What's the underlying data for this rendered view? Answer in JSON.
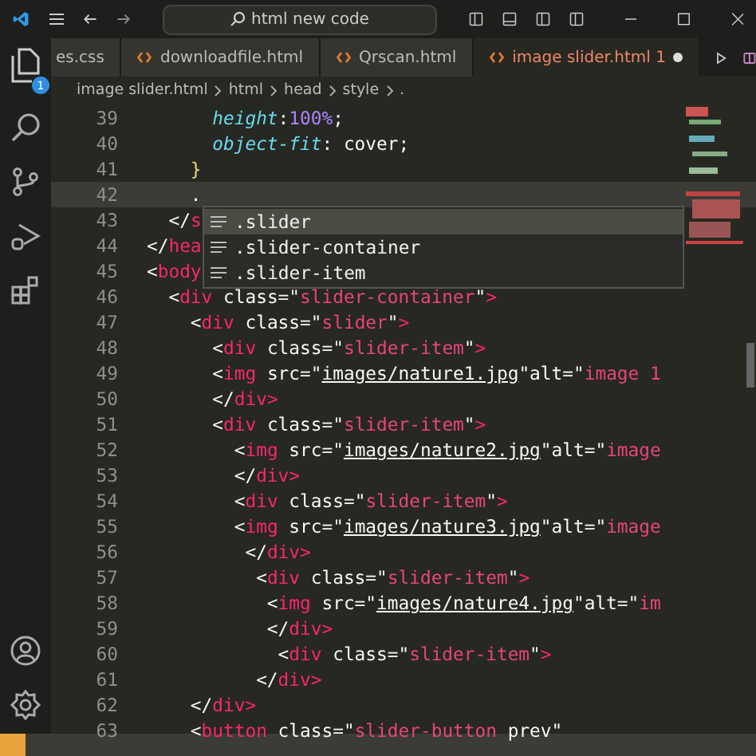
{
  "title_bar": {
    "search": "html new code"
  },
  "tabs": [
    {
      "label": "es.css",
      "selected": false,
      "icon": false
    },
    {
      "label": "downloadfile.html",
      "selected": false,
      "icon": true
    },
    {
      "label": "Qrscan.html",
      "selected": false,
      "icon": true
    },
    {
      "label": "image slider.html 1",
      "selected": true,
      "icon": true
    }
  ],
  "activity_badge": "1",
  "breadcrumb": [
    "image slider.html",
    "html",
    "head",
    "style",
    "."
  ],
  "lines": [
    {
      "n": "39",
      "active": false,
      "tokens": [
        {
          "kind": "prop",
          "t": "      height"
        },
        {
          "kind": "p",
          "t": ":"
        },
        {
          "kind": "num",
          "t": "100%"
        },
        {
          "kind": "p",
          "t": ";"
        }
      ]
    },
    {
      "n": "40",
      "active": false,
      "tokens": [
        {
          "kind": "prop",
          "t": "      object-fit"
        },
        {
          "kind": "p",
          "t": ": cover;"
        }
      ]
    },
    {
      "n": "41",
      "active": false,
      "tokens": [
        {
          "kind": "brace",
          "t": "    }"
        }
      ]
    },
    {
      "n": "42",
      "active": true,
      "tokens": [
        {
          "kind": "p",
          "t": "    ."
        }
      ]
    },
    {
      "n": "43",
      "active": false,
      "tokens": [
        {
          "kind": "p",
          "t": "  </"
        },
        {
          "kind": "tag",
          "t": "s"
        }
      ]
    },
    {
      "n": "44",
      "active": false,
      "tokens": [
        {
          "kind": "p",
          "t": "</"
        },
        {
          "kind": "tag",
          "t": "hea"
        }
      ]
    },
    {
      "n": "45",
      "active": false,
      "tokens": [
        {
          "kind": "p",
          "t": "<"
        },
        {
          "kind": "tag",
          "t": "body"
        }
      ]
    },
    {
      "n": "46",
      "active": false,
      "tokens": [
        {
          "kind": "p",
          "t": "  <"
        },
        {
          "kind": "tag",
          "t": "div"
        },
        {
          "kind": "p",
          "t": " class=\""
        },
        {
          "kind": "str",
          "t": "slider-container"
        },
        {
          "kind": "p",
          "t": "\""
        },
        {
          "kind": "tag",
          "t": ">"
        }
      ]
    },
    {
      "n": "47",
      "active": false,
      "tokens": [
        {
          "kind": "p",
          "t": "    <"
        },
        {
          "kind": "tag",
          "t": "div"
        },
        {
          "kind": "p",
          "t": " class=\""
        },
        {
          "kind": "str",
          "t": "slider"
        },
        {
          "kind": "p",
          "t": "\""
        },
        {
          "kind": "tag",
          "t": ">"
        }
      ]
    },
    {
      "n": "48",
      "active": false,
      "tokens": [
        {
          "kind": "p",
          "t": "      <"
        },
        {
          "kind": "tag",
          "t": "div"
        },
        {
          "kind": "p",
          "t": " class=\""
        },
        {
          "kind": "str",
          "t": "slider-item"
        },
        {
          "kind": "p",
          "t": "\""
        },
        {
          "kind": "tag",
          "t": ">"
        }
      ]
    },
    {
      "n": "49",
      "active": false,
      "tokens": [
        {
          "kind": "p",
          "t": "      <"
        },
        {
          "kind": "tag",
          "t": "img"
        },
        {
          "kind": "p",
          "t": " src=\""
        },
        {
          "kind": "link",
          "t": "images/nature1.jpg"
        },
        {
          "kind": "p",
          "t": "\"alt=\""
        },
        {
          "kind": "str",
          "t": "image 1"
        }
      ]
    },
    {
      "n": "50",
      "active": false,
      "tokens": [
        {
          "kind": "p",
          "t": "      </"
        },
        {
          "kind": "tag",
          "t": "div>"
        }
      ]
    },
    {
      "n": "51",
      "active": false,
      "tokens": [
        {
          "kind": "p",
          "t": "      <"
        },
        {
          "kind": "tag",
          "t": "div"
        },
        {
          "kind": "p",
          "t": " class=\""
        },
        {
          "kind": "str",
          "t": "slider-item"
        },
        {
          "kind": "p",
          "t": "\""
        },
        {
          "kind": "tag",
          "t": ">"
        }
      ]
    },
    {
      "n": "52",
      "active": false,
      "tokens": [
        {
          "kind": "p",
          "t": "        <"
        },
        {
          "kind": "tag",
          "t": "img"
        },
        {
          "kind": "p",
          "t": " src=\""
        },
        {
          "kind": "link",
          "t": "images/nature2.jpg"
        },
        {
          "kind": "p",
          "t": "\"alt=\""
        },
        {
          "kind": "str",
          "t": "image"
        }
      ]
    },
    {
      "n": "53",
      "active": false,
      "tokens": [
        {
          "kind": "p",
          "t": "        </"
        },
        {
          "kind": "tag",
          "t": "div>"
        }
      ]
    },
    {
      "n": "54",
      "active": false,
      "tokens": [
        {
          "kind": "p",
          "t": "        <"
        },
        {
          "kind": "tag",
          "t": "div"
        },
        {
          "kind": "p",
          "t": " class=\""
        },
        {
          "kind": "str",
          "t": "slider-item"
        },
        {
          "kind": "p",
          "t": "\""
        },
        {
          "kind": "tag",
          "t": ">"
        }
      ]
    },
    {
      "n": "55",
      "active": false,
      "tokens": [
        {
          "kind": "p",
          "t": "        <"
        },
        {
          "kind": "tag",
          "t": "img"
        },
        {
          "kind": "p",
          "t": " src=\""
        },
        {
          "kind": "link",
          "t": "images/nature3.jpg"
        },
        {
          "kind": "p",
          "t": "\"alt=\""
        },
        {
          "kind": "str",
          "t": "image"
        }
      ]
    },
    {
      "n": "56",
      "active": false,
      "tokens": [
        {
          "kind": "p",
          "t": "         </"
        },
        {
          "kind": "tag",
          "t": "div>"
        }
      ]
    },
    {
      "n": "57",
      "active": false,
      "tokens": [
        {
          "kind": "p",
          "t": "          <"
        },
        {
          "kind": "tag",
          "t": "div"
        },
        {
          "kind": "p",
          "t": " class=\""
        },
        {
          "kind": "str",
          "t": "slider-item"
        },
        {
          "kind": "p",
          "t": "\""
        },
        {
          "kind": "tag",
          "t": ">"
        }
      ]
    },
    {
      "n": "58",
      "active": false,
      "tokens": [
        {
          "kind": "p",
          "t": "           <"
        },
        {
          "kind": "tag",
          "t": "img"
        },
        {
          "kind": "p",
          "t": " src=\""
        },
        {
          "kind": "link",
          "t": "images/nature4.jpg"
        },
        {
          "kind": "p",
          "t": "\"alt=\""
        },
        {
          "kind": "str",
          "t": "im"
        }
      ]
    },
    {
      "n": "59",
      "active": false,
      "tokens": [
        {
          "kind": "p",
          "t": "           </"
        },
        {
          "kind": "tag",
          "t": "div>"
        }
      ]
    },
    {
      "n": "60",
      "active": false,
      "tokens": [
        {
          "kind": "p",
          "t": "            <"
        },
        {
          "kind": "tag",
          "t": "div"
        },
        {
          "kind": "p",
          "t": " class=\""
        },
        {
          "kind": "str",
          "t": "slider-item"
        },
        {
          "kind": "p",
          "t": "\""
        },
        {
          "kind": "tag",
          "t": ">"
        }
      ]
    },
    {
      "n": "61",
      "active": false,
      "tokens": [
        {
          "kind": "p",
          "t": "          </"
        },
        {
          "kind": "tag",
          "t": "div>"
        }
      ]
    },
    {
      "n": "62",
      "active": false,
      "tokens": [
        {
          "kind": "p",
          "t": "    </"
        },
        {
          "kind": "tag",
          "t": "div>"
        }
      ]
    },
    {
      "n": "63",
      "active": false,
      "tokens": [
        {
          "kind": "p",
          "t": "    <"
        },
        {
          "kind": "tag",
          "t": "button"
        },
        {
          "kind": "p",
          "t": " class=\""
        },
        {
          "kind": "str",
          "t": "slider-button"
        },
        {
          "kind": "p",
          "t": " prev\""
        }
      ]
    }
  ],
  "suggest": {
    "items": [
      {
        "label": ".slider",
        "selected": true
      },
      {
        "label": ".slider-container",
        "selected": false
      },
      {
        "label": ".slider-item",
        "selected": false
      }
    ]
  }
}
